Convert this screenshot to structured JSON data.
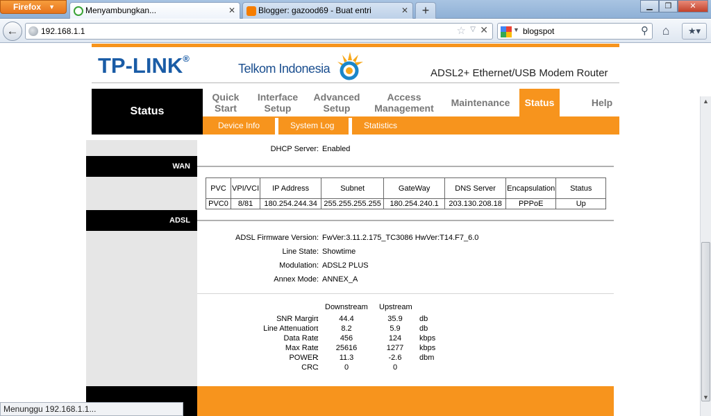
{
  "browser": {
    "firefox_label": "Firefox",
    "tabs": [
      {
        "title": "Menyambungkan...",
        "active": true
      },
      {
        "title": "Blogger: gazood69 - Buat entri",
        "active": false
      }
    ],
    "new_tab": "+",
    "window_buttons": {
      "minimize": "▁",
      "maximize": "❐",
      "close": "✕"
    },
    "url": "192.168.1.1",
    "search_value": "blogspot",
    "status_text": "Menunggu 192.168.1.1..."
  },
  "icons": {
    "back": "back-arrow-icon",
    "globe": "globe-icon",
    "star": "bookmark-star-icon",
    "stop": "stop-icon",
    "google": "google-icon",
    "search": "magnifier-icon",
    "home": "home-icon",
    "bookmarks": "bookmarks-icon"
  },
  "router": {
    "logo": "TP-LINK",
    "logo_reg": "®",
    "partner": "Telkom Indonesia",
    "model": "ADSL2+ Ethernet/USB Modem Router",
    "section_title": "Status",
    "menu": [
      {
        "label": "Quick Start",
        "active": false
      },
      {
        "label": "Interface Setup",
        "active": false
      },
      {
        "label": "Advanced Setup",
        "active": false
      },
      {
        "label": "Access Management",
        "active": false
      },
      {
        "label": "Maintenance",
        "active": false
      },
      {
        "label": "Status",
        "active": true
      },
      {
        "label": "Help",
        "active": false
      }
    ],
    "submenu": [
      "Device Info",
      "System Log",
      "Statistics"
    ],
    "colors": {
      "accent": "#f7941d",
      "brand_blue": "#1a5ca6"
    }
  },
  "status": {
    "dhcp": {
      "label": "DHCP Server",
      "value": "Enabled"
    },
    "wan_label": "WAN",
    "wan_table": {
      "headers": [
        "PVC",
        "VPI/VCI",
        "IP Address",
        "Subnet",
        "GateWay",
        "DNS Server",
        "Encapsulation",
        "Status"
      ],
      "rows": [
        [
          "PVC0",
          "8/81",
          "180.254.244.34",
          "255.255.255.255",
          "180.254.240.1",
          "203.130.208.18",
          "PPPoE",
          "Up"
        ]
      ]
    },
    "adsl_label": "ADSL",
    "adsl": [
      {
        "label": "ADSL Firmware Version",
        "value": "FwVer:3.11.2.175_TC3086 HwVer:T14.F7_6.0"
      },
      {
        "label": "Line State",
        "value": "Showtime"
      },
      {
        "label": "Modulation",
        "value": "ADSL2 PLUS"
      },
      {
        "label": "Annex Mode",
        "value": "ANNEX_A"
      }
    ],
    "stats_headers": {
      "downstream": "Downstream",
      "upstream": "Upstream"
    },
    "stats": [
      {
        "label": "SNR Margin",
        "down": "44.4",
        "up": "35.9",
        "unit": "db"
      },
      {
        "label": "Line Attenuation",
        "down": "8.2",
        "up": "5.9",
        "unit": "db"
      },
      {
        "label": "Data Rate",
        "down": "456",
        "up": "124",
        "unit": "kbps"
      },
      {
        "label": "Max Rate",
        "down": "25616",
        "up": "1277",
        "unit": "kbps"
      },
      {
        "label": "POWER",
        "down": "11.3",
        "up": "-2.6",
        "unit": "dbm"
      },
      {
        "label": "CRC",
        "down": "0",
        "up": "0",
        "unit": ""
      }
    ],
    "colon": ":"
  }
}
